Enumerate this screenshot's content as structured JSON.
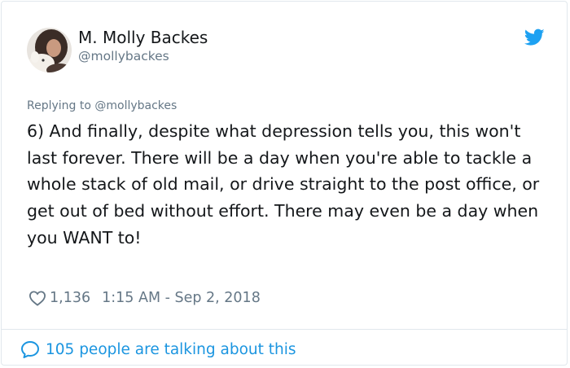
{
  "author": {
    "display_name": "M. Molly Backes",
    "handle": "@mollybackes"
  },
  "replying_to": "Replying to @mollybackes",
  "tweet": {
    "text": "6) And finally, despite what depression tells you, this won't last forever. There will be a day when you're able to tackle a whole stack of old mail, or drive straight to the post office, or get out of bed without effort. There may even be a day when you WANT to!",
    "likes": "1,136",
    "timestamp": "1:15 AM - Sep 2, 2018"
  },
  "footer": {
    "talking_text": "105 people are talking about this"
  },
  "icons": {
    "brand": "twitter-bird-icon",
    "like": "heart-icon",
    "reply": "speech-bubble-icon"
  },
  "colors": {
    "brand_blue": "#1da1f2",
    "link_blue": "#1b95e0",
    "muted_gray": "#657786",
    "text": "#14171a"
  }
}
